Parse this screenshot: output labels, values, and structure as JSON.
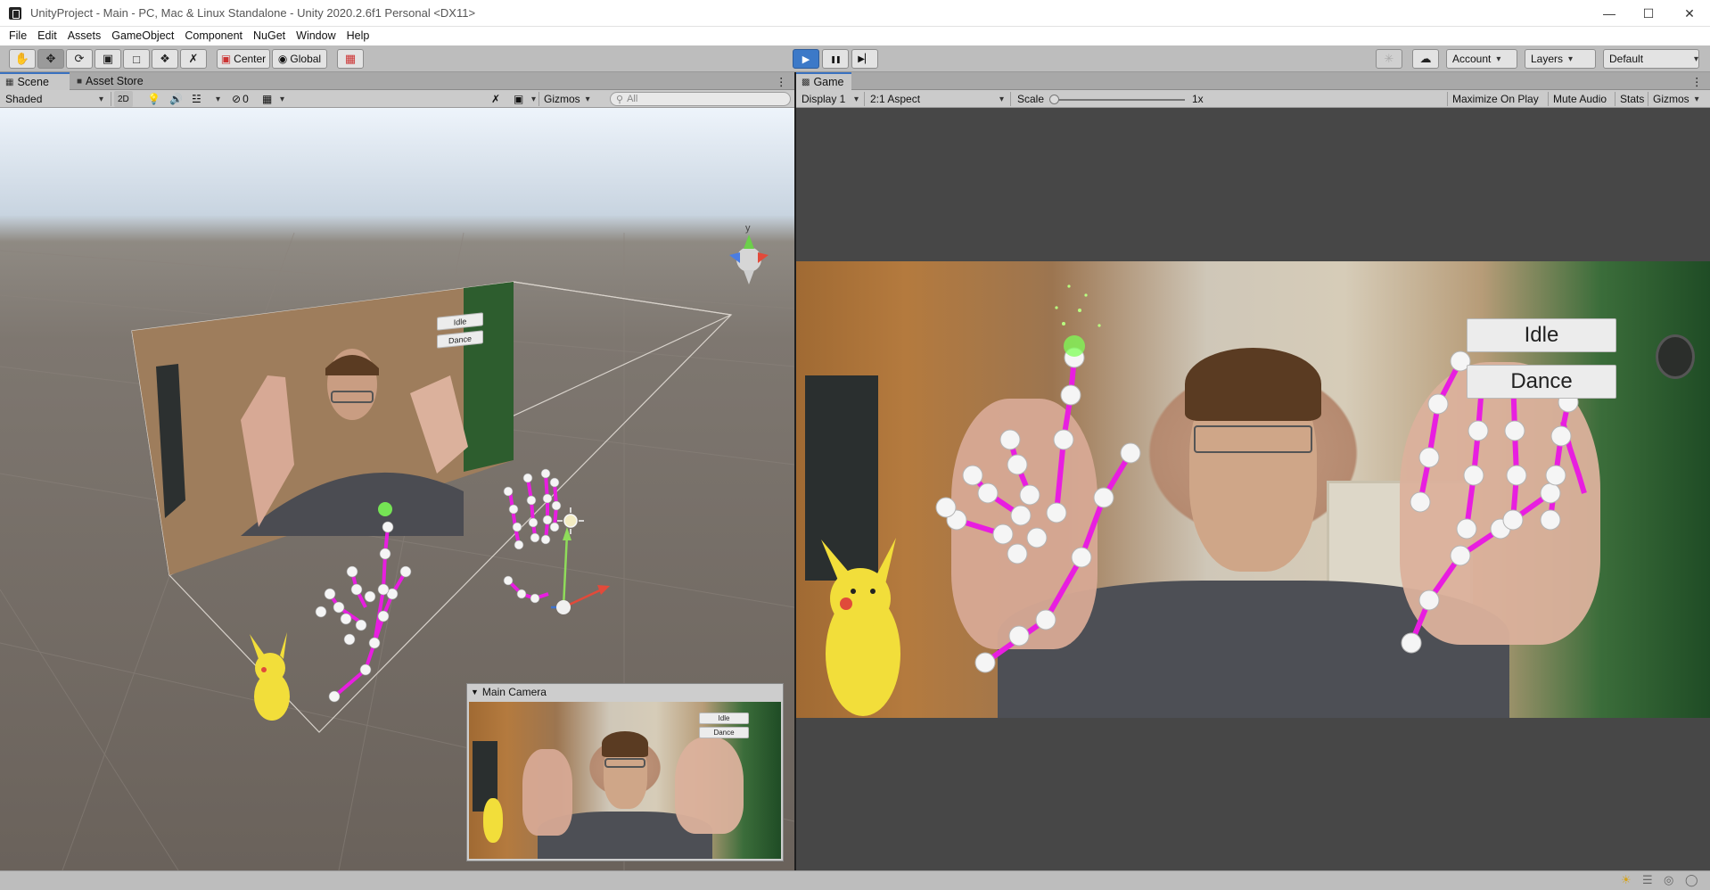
{
  "window": {
    "title": "UnityProject - Main - PC, Mac & Linux Standalone - Unity 2020.2.6f1 Personal <DX11>",
    "minimize": "—",
    "maximize": "☐",
    "close": "✕"
  },
  "menu": [
    "File",
    "Edit",
    "Assets",
    "GameObject",
    "Component",
    "NuGet",
    "Window",
    "Help"
  ],
  "toolbar": {
    "tools": [
      "hand-tool",
      "move-tool",
      "rotate-tool",
      "scale-tool",
      "rect-tool",
      "transform-tool",
      "custom-tool"
    ],
    "pivot_label": "Center",
    "space_label": "Global",
    "play": "▶",
    "pause": "❚❚",
    "step": "▶▏",
    "account_label": "Account",
    "layers_label": "Layers",
    "layout_label": "Default"
  },
  "scene_panel": {
    "tabs": [
      "Scene",
      "Asset Store"
    ],
    "shading": "Shaded",
    "mode_2d": "2D",
    "hidden_count": "0",
    "gizmos": "Gizmos",
    "search_placeholder": "All",
    "gizmo_axis_y": "y",
    "overlay_buttons": [
      "Idle",
      "Dance"
    ],
    "camera_preview_title": "Main Camera",
    "preview_buttons": [
      "Idle",
      "Dance"
    ]
  },
  "game_panel": {
    "tab": "Game",
    "display": "Display 1",
    "aspect": "2:1 Aspect",
    "scale_label": "Scale",
    "scale_value": "1x",
    "maximize_on_play": "Maximize On Play",
    "mute_audio": "Mute Audio",
    "stats": "Stats",
    "gizmos": "Gizmos",
    "ui_buttons": [
      "Idle",
      "Dance"
    ]
  },
  "colors": {
    "play_active": "#3c79c8",
    "skeleton": "#e81ee0",
    "joint": "#f2f2f2",
    "particles": "#7dff55"
  }
}
